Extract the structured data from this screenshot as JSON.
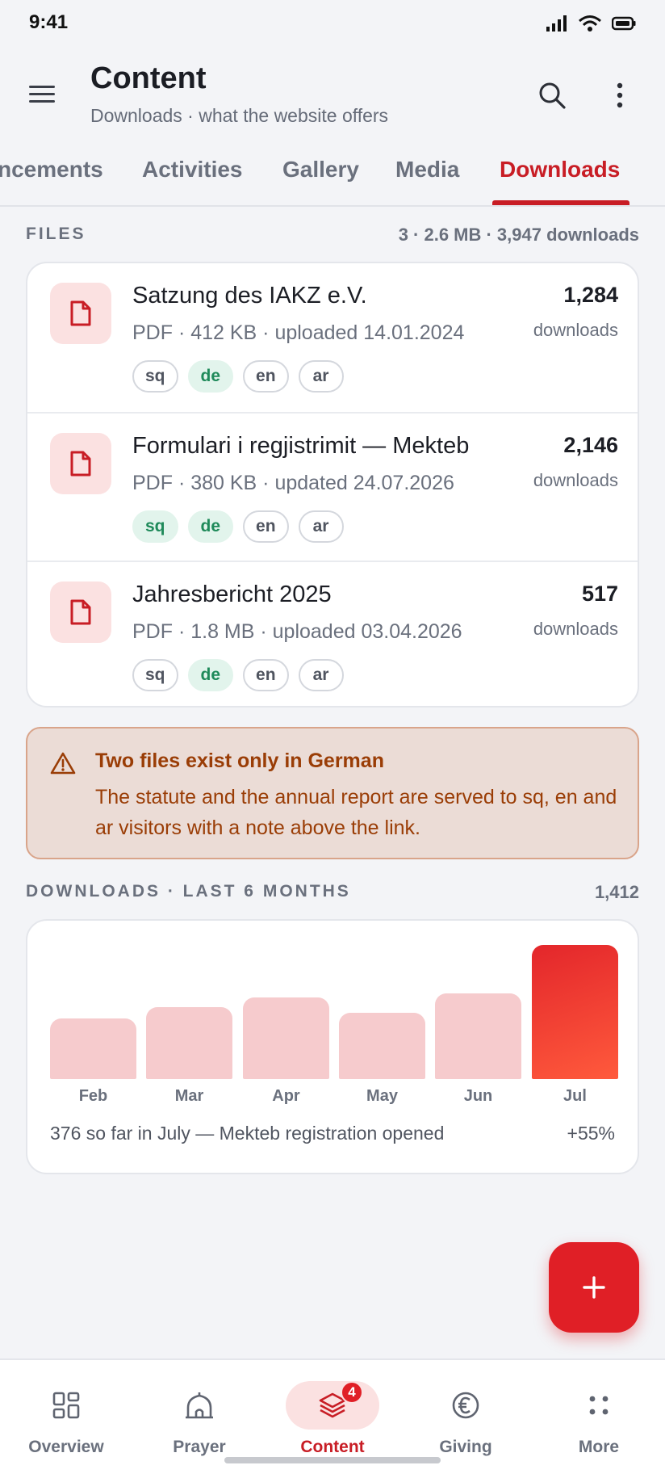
{
  "status": {
    "time": "9:41"
  },
  "header": {
    "title": "Content",
    "subtitle": "Downloads · what the website offers"
  },
  "tabs": [
    {
      "label": "Announcements",
      "visible_text": "ncements"
    },
    {
      "label": "Activities"
    },
    {
      "label": "Gallery"
    },
    {
      "label": "Media"
    },
    {
      "label": "Downloads",
      "active": true
    }
  ],
  "files_section": {
    "label": "FILES",
    "meta": "3 · 2.6 MB · 3,947 downloads"
  },
  "files": [
    {
      "name": "Satzung des IAKZ e.V.",
      "meta": "PDF · 412 KB · uploaded 14.01.2024",
      "count": "1,284",
      "count_label": "downloads",
      "langs": [
        {
          "code": "sq",
          "available": false
        },
        {
          "code": "de",
          "available": true
        },
        {
          "code": "en",
          "available": false
        },
        {
          "code": "ar",
          "available": false
        }
      ]
    },
    {
      "name": "Formulari i regjistrimit — Mekteb",
      "meta": "PDF · 380 KB · updated 24.07.2026",
      "count": "2,146",
      "count_label": "downloads",
      "langs": [
        {
          "code": "sq",
          "available": true
        },
        {
          "code": "de",
          "available": true
        },
        {
          "code": "en",
          "available": false
        },
        {
          "code": "ar",
          "available": false
        }
      ]
    },
    {
      "name": "Jahresbericht 2025",
      "meta": "PDF · 1.8 MB · uploaded 03.04.2026",
      "count": "517",
      "count_label": "downloads",
      "langs": [
        {
          "code": "sq",
          "available": false
        },
        {
          "code": "de",
          "available": true
        },
        {
          "code": "en",
          "available": false
        },
        {
          "code": "ar",
          "available": false
        }
      ]
    }
  ],
  "warning": {
    "title": "Two files exist only in German",
    "body": "The statute and the annual report are served to sq, en and ar visitors with a note above the link."
  },
  "chart_section": {
    "label": "DOWNLOADS · LAST 6 MONTHS",
    "total": "1,412"
  },
  "chart_data": {
    "type": "bar",
    "categories": [
      "Feb",
      "Mar",
      "Apr",
      "May",
      "Jun",
      "Jul"
    ],
    "values": [
      155,
      185,
      210,
      170,
      220,
      345
    ],
    "highlight_index": 5,
    "ylim": [
      0,
      345
    ],
    "note": "376 so far in July — Mekteb registration opened",
    "delta": "+55%",
    "colors": {
      "bar": "#f6cbcd",
      "highlight_from": "#e3262b",
      "highlight_to": "#ff5a3c"
    }
  },
  "fab": {
    "icon": "plus-icon"
  },
  "bottom_nav": [
    {
      "label": "Overview",
      "icon": "grid-icon"
    },
    {
      "label": "Prayer",
      "icon": "mosque-icon"
    },
    {
      "label": "Content",
      "icon": "layers-icon",
      "active": true,
      "badge": "4"
    },
    {
      "label": "Giving",
      "icon": "euro-icon"
    },
    {
      "label": "More",
      "icon": "dots-grid-icon"
    }
  ],
  "colors": {
    "accent": "#c81d25",
    "fab": "#e01f26",
    "success": "#1f8a5a",
    "warning": "#9a3d06"
  }
}
